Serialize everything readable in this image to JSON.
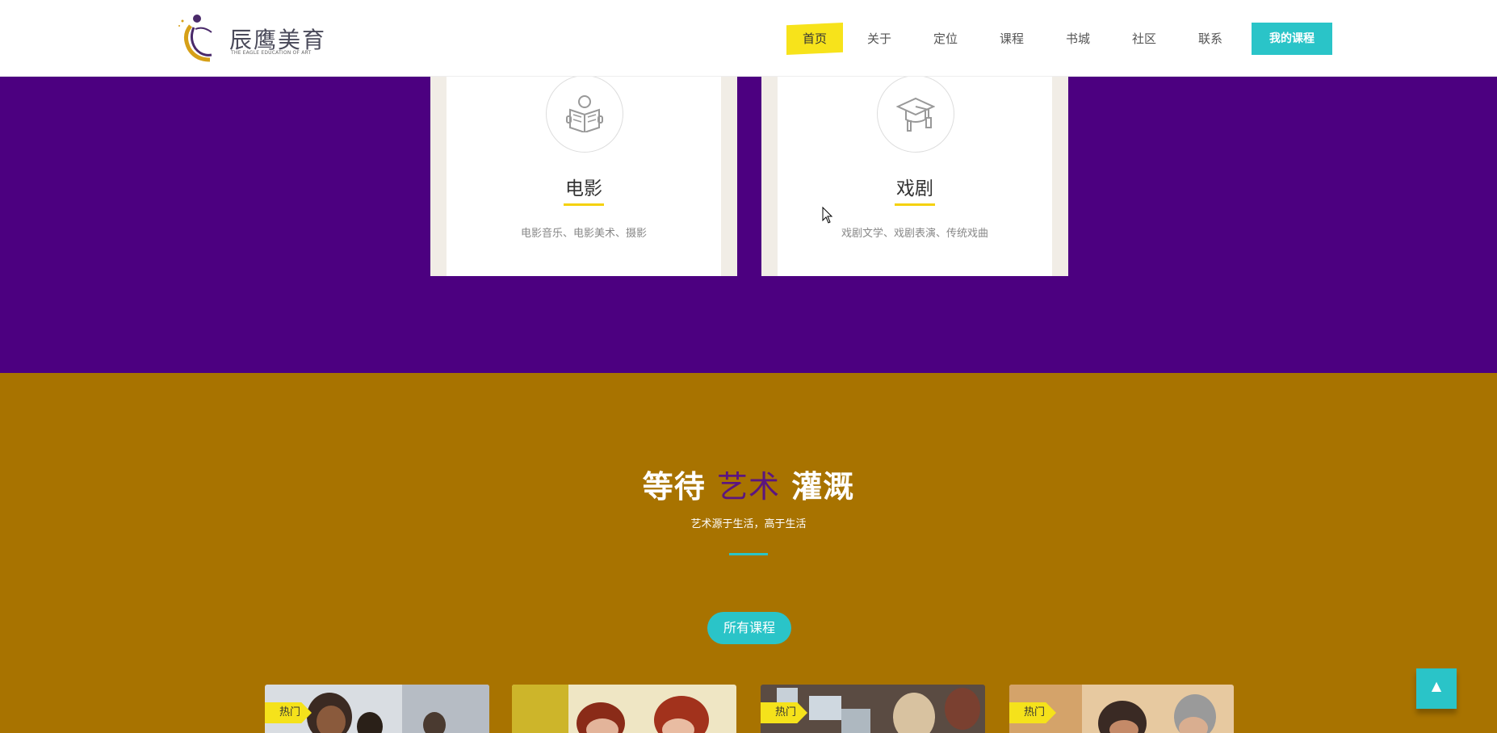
{
  "header": {
    "logo_cn": "辰鹰美育",
    "logo_en": "THE EAGLE EDUCATION OF ART",
    "nav": [
      "首页",
      "关于",
      "定位",
      "课程",
      "书城",
      "社区",
      "联系"
    ],
    "active_nav": "首页",
    "my_course_label": "我的课程"
  },
  "categories": [
    {
      "icon": "reading-book-icon",
      "title": "电影",
      "desc": "电影音乐、电影美术、摄影"
    },
    {
      "icon": "graduation-cap-icon",
      "title": "戏剧",
      "desc": "戏剧文学、戏剧表演、传统戏曲"
    }
  ],
  "section": {
    "title_part1": "等待",
    "title_accent": "艺术",
    "title_part2": "灌溉",
    "subtitle": "艺术源于生活，高于生活",
    "all_courses_label": "所有课程"
  },
  "courses": [
    {
      "tag": "热门"
    },
    {
      "tag": ""
    },
    {
      "tag": "热门"
    },
    {
      "tag": "热门"
    }
  ],
  "colors": {
    "purple_band": "#4c0080",
    "gold_band": "#a87300",
    "teal": "#2ac4c8",
    "yellow": "#f7e31b"
  }
}
